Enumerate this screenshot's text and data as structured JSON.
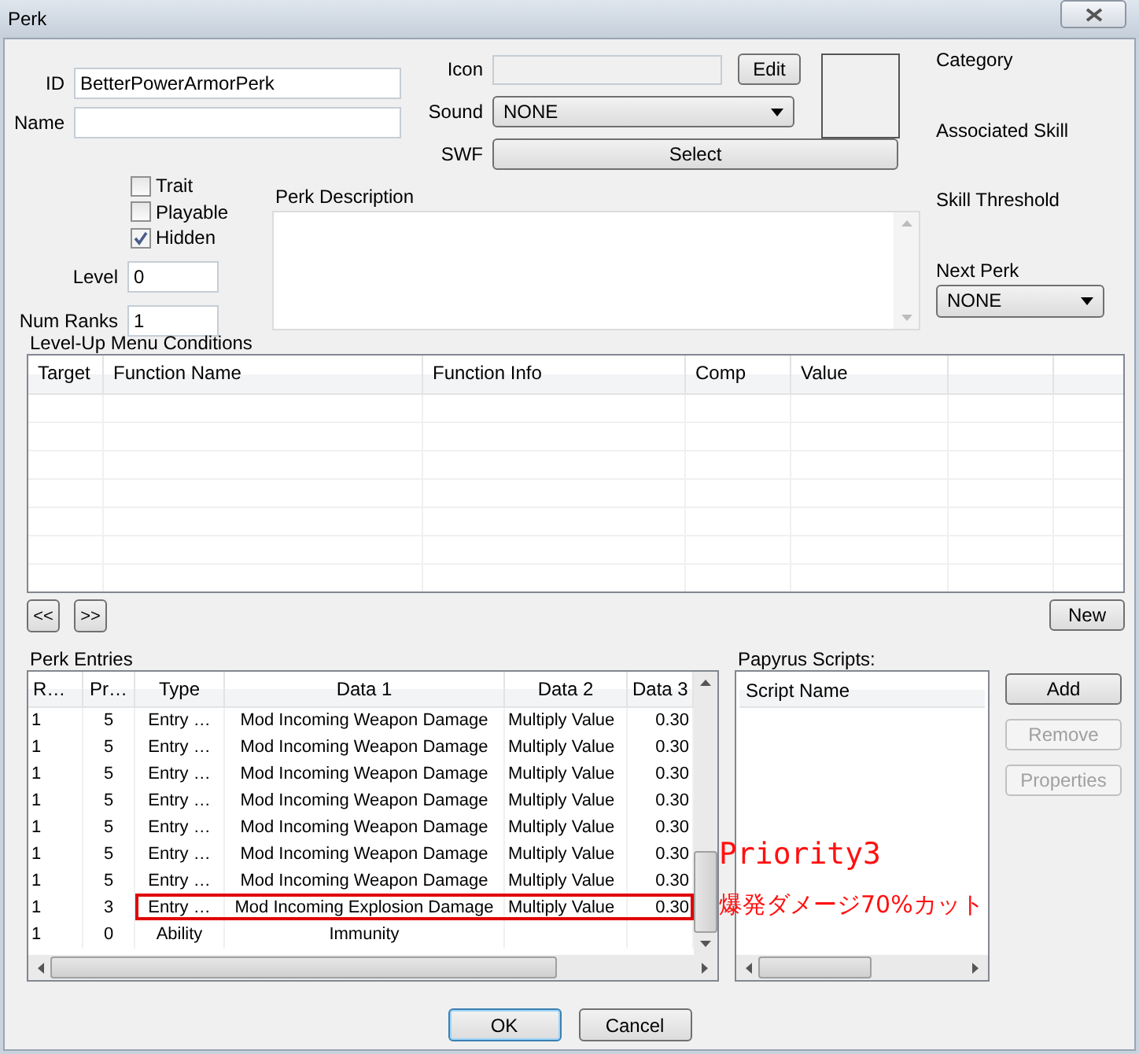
{
  "window": {
    "title": "Perk"
  },
  "id": {
    "label": "ID",
    "value": "BetterPowerArmorPerk"
  },
  "name": {
    "label": "Name"
  },
  "flags": [
    {
      "label": "Trait",
      "checked": false
    },
    {
      "label": "Playable",
      "checked": false
    },
    {
      "label": "Hidden",
      "checked": true
    }
  ],
  "level": {
    "label": "Level",
    "value": "0"
  },
  "num_ranks": {
    "label": "Num Ranks",
    "value": "1"
  },
  "icon": {
    "label": "Icon",
    "button": "Edit"
  },
  "sound": {
    "label": "Sound",
    "value": "NONE"
  },
  "swf": {
    "label": "SWF",
    "button": "Select"
  },
  "description": {
    "label": "Perk Description"
  },
  "category": {
    "label": "Category"
  },
  "associated_skill": {
    "label": "Associated Skill"
  },
  "skill_threshold": {
    "label": "Skill Threshold"
  },
  "next_perk": {
    "label": "Next Perk",
    "value": "NONE"
  },
  "conditions": {
    "title": "Level-Up Menu Conditions",
    "columns": [
      "Target",
      "Function Name",
      "Function Info",
      "Comp",
      "Value"
    ],
    "prev": "<<",
    "next": ">>",
    "new": "New"
  },
  "perk_entries": {
    "title": "Perk Entries",
    "columns": [
      "R…",
      "Pr…",
      "Type",
      "Data 1",
      "Data 2",
      "Data 3"
    ],
    "rows": [
      {
        "rank": "1",
        "priority": "5",
        "type": "Entry …",
        "data_1": "Mod Incoming Weapon Damage",
        "data_2": "Multiply Value",
        "data_3": "0.30",
        "highlighted": false
      },
      {
        "rank": "1",
        "priority": "5",
        "type": "Entry …",
        "data_1": "Mod Incoming Weapon Damage",
        "data_2": "Multiply Value",
        "data_3": "0.30",
        "highlighted": false
      },
      {
        "rank": "1",
        "priority": "5",
        "type": "Entry …",
        "data_1": "Mod Incoming Weapon Damage",
        "data_2": "Multiply Value",
        "data_3": "0.30",
        "highlighted": false
      },
      {
        "rank": "1",
        "priority": "5",
        "type": "Entry …",
        "data_1": "Mod Incoming Weapon Damage",
        "data_2": "Multiply Value",
        "data_3": "0.30",
        "highlighted": false
      },
      {
        "rank": "1",
        "priority": "5",
        "type": "Entry …",
        "data_1": "Mod Incoming Weapon Damage",
        "data_2": "Multiply Value",
        "data_3": "0.30",
        "highlighted": false
      },
      {
        "rank": "1",
        "priority": "5",
        "type": "Entry …",
        "data_1": "Mod Incoming Weapon Damage",
        "data_2": "Multiply Value",
        "data_3": "0.30",
        "highlighted": false
      },
      {
        "rank": "1",
        "priority": "5",
        "type": "Entry …",
        "data_1": "Mod Incoming Weapon Damage",
        "data_2": "Multiply Value",
        "data_3": "0.30",
        "highlighted": false
      },
      {
        "rank": "1",
        "priority": "3",
        "type": "Entry …",
        "data_1": "Mod Incoming Explosion Damage",
        "data_2": "Multiply Value",
        "data_3": "0.30",
        "highlighted": true
      },
      {
        "rank": "1",
        "priority": "0",
        "type": "Ability",
        "data_1": "Immunity",
        "highlighted": false
      }
    ]
  },
  "papyrus": {
    "title": "Papyrus Scripts:",
    "column": "Script Name",
    "buttons": [
      {
        "label": "Add",
        "disabled": false
      },
      {
        "label": "Remove",
        "disabled": true
      },
      {
        "label": "Properties",
        "disabled": true
      }
    ]
  },
  "annotation": {
    "title": "Priority3",
    "note": "爆発ダメージ70%カット"
  },
  "dialog_buttons": [
    {
      "label": "OK",
      "default": true
    },
    {
      "label": "Cancel",
      "default": false
    }
  ]
}
